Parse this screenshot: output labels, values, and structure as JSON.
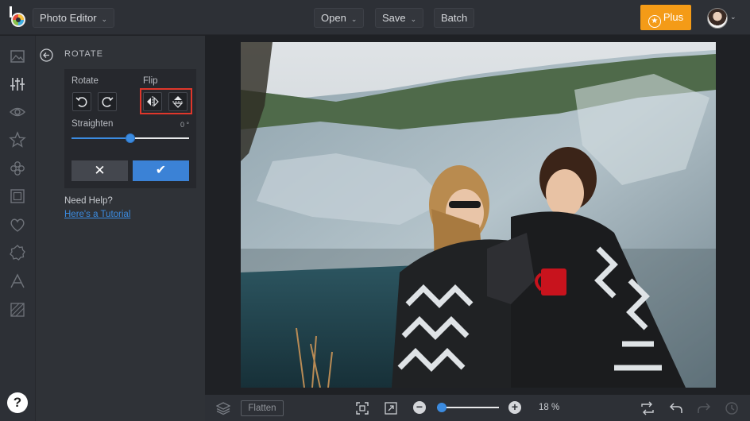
{
  "topbar": {
    "app_label": "Photo Editor",
    "open_label": "Open",
    "save_label": "Save",
    "batch_label": "Batch",
    "plus_label": "Plus"
  },
  "rail": {
    "icons": [
      "image-icon",
      "sliders-icon",
      "eye-icon",
      "star-icon",
      "flower-icon",
      "frame-icon",
      "heart-icon",
      "badge-icon",
      "text-icon",
      "texture-icon"
    ],
    "help_label": "?"
  },
  "panel": {
    "title": "ROTATE",
    "rotate_label": "Rotate",
    "flip_label": "Flip",
    "straighten_label": "Straighten",
    "straighten_value": "0 °",
    "straighten_fraction": 0.5,
    "need_help": "Need Help?",
    "tutorial_link": "Here's a Tutorial"
  },
  "bottombar": {
    "flatten_label": "Flatten",
    "zoom_label": "18 %",
    "zoom_fraction": 0.0
  },
  "colors": {
    "accent": "#3b82d6",
    "plus": "#f49b17",
    "highlight": "#e0372b"
  }
}
